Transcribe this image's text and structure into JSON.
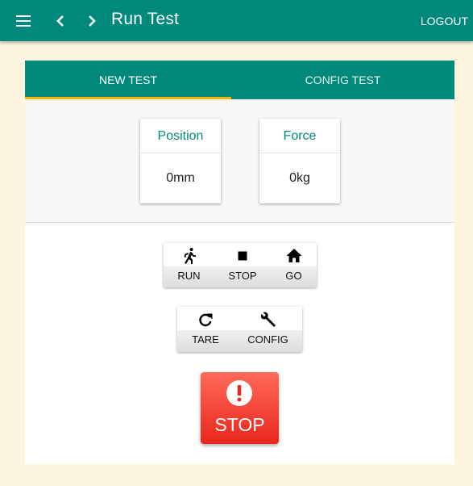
{
  "appbar": {
    "title": "Run Test",
    "logout_label": "LOGOUT",
    "bg_color": "#00897b",
    "icons": [
      "menu-icon",
      "chevron-left-icon",
      "chevron-right-icon"
    ]
  },
  "tabs": [
    {
      "label": "NEW TEST",
      "active": true
    },
    {
      "label": "CONFIG TEST",
      "active": false
    }
  ],
  "accent_color": "#f2b705",
  "readouts": {
    "position": {
      "label": "Position",
      "value": "0mm"
    },
    "force": {
      "label": "Force",
      "value": "0kg"
    }
  },
  "controls": {
    "run": {
      "label": "RUN",
      "icon": "run-icon"
    },
    "stop": {
      "label": "STOP",
      "icon": "stop-icon"
    },
    "go": {
      "label": "GO",
      "icon": "home-icon"
    },
    "tare": {
      "label": "TARE",
      "icon": "refresh-icon"
    },
    "config": {
      "label": "CONFIG",
      "icon": "wrench-icon"
    }
  },
  "emergency_stop": {
    "label": "STOP",
    "icon": "alert-icon",
    "color": "#e8261c"
  }
}
